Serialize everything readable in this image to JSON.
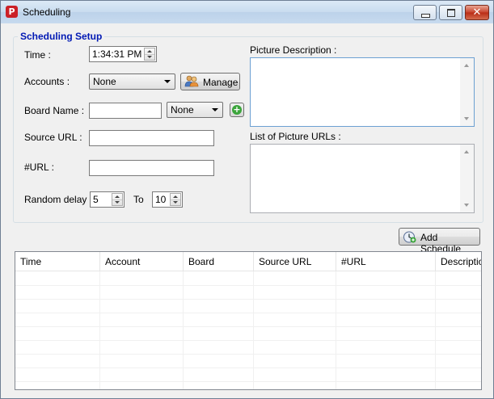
{
  "window": {
    "title": "Scheduling",
    "app_icon": "pinterest-icon",
    "accent": "#cb2027"
  },
  "setup": {
    "group_title": "Scheduling Setup",
    "time_label": "Time :",
    "time_value": "1:34:31 PM",
    "accounts_label": "Accounts :",
    "accounts_selected": "None",
    "manage_button": "Manage",
    "board_name_label": "Board Name :",
    "board_name_value": "",
    "board_select_selected": "None",
    "source_url_label": "Source URL :",
    "source_url_value": "",
    "hash_url_label": "#URL :",
    "hash_url_value": "",
    "random_delay_label": "Random delay :",
    "delay_from": "5",
    "to_label": "To",
    "delay_to": "10",
    "picture_description_label": "Picture Description :",
    "picture_urls_label": "List of Picture URLs :"
  },
  "actions": {
    "add_schedule_button": "Add Schedule"
  },
  "table": {
    "columns": [
      "Time",
      "Account",
      "Board",
      "Source URL",
      "#URL",
      "Descriptio"
    ],
    "rows": []
  }
}
